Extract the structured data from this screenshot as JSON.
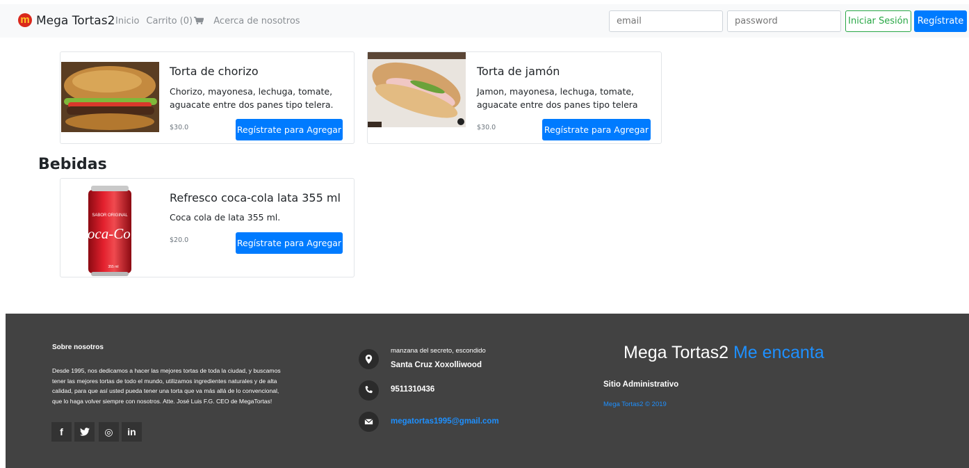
{
  "navbar": {
    "brand": "Mega Tortas2",
    "links": {
      "home": "Inicio",
      "cart": "Carrito (0)",
      "about": "Acerca de nosotros"
    },
    "email_placeholder": "email",
    "password_placeholder": "password",
    "login_label": "Iniciar Sesión",
    "register_label": "Regístrate"
  },
  "products": [
    {
      "title": "Torta de chorizo",
      "desc_line1": "Chorizo, mayonesa, lechuga, tomate,",
      "desc_line2": "aguacate entre dos panes tipo telera.",
      "price": "$30.0",
      "button": "Regístrate para Agregar"
    },
    {
      "title": "Torta de jamón",
      "desc_line1": "Jamon, mayonesa, lechuga, tomate,",
      "desc_line2": "aguacate entre dos panes tipo telera",
      "price": "$30.0",
      "button": "Regístrate para Agregar"
    }
  ],
  "drinks_section": {
    "title": "Bebidas",
    "items": [
      {
        "title": "Refresco coca-cola lata 355 ml",
        "desc": "Coca cola de lata 355 ml.",
        "price": "$20.0",
        "button": "Regístrate para Agregar",
        "can_text_top": "SABOR ORIGINAL",
        "can_logo": "Coca-Cola",
        "can_volume": "355 ml"
      }
    ]
  },
  "footer": {
    "about_title": "Sobre nosotros",
    "about_lines": [
      "Desde 1995, nos dedicamos a hacer las mejores tortas de toda la ciudad, y buscamos",
      "tener las mejores tortas de todo el mundo, utilizamos ingredientes naturales y de alta",
      "calidad, para que así usted pueda tener una torta que va más allá de lo convencional,",
      "que lo haga volver siempre con nosotros. Atte. José Luis F.G. CEO de MegaTortas!"
    ],
    "social": {
      "facebook": "f",
      "twitter": "t",
      "instagram": "◎",
      "linkedin": "in"
    },
    "address_line1": "manzana del secreto, escondido",
    "address_line2": "Santa Cruz Xoxolliwood",
    "phone": "9511310436",
    "email": "megatortas1995@gmail.com",
    "brand_main": "Mega Tortas2",
    "brand_accent": "Me encanta",
    "admin": "Sitio Administrativo",
    "copyright": "Mega Tortas2 © 2019"
  },
  "colors": {
    "primary": "#007bff",
    "success": "#28a745",
    "footer_bg": "#424242",
    "accent_link": "#1e90ff"
  }
}
